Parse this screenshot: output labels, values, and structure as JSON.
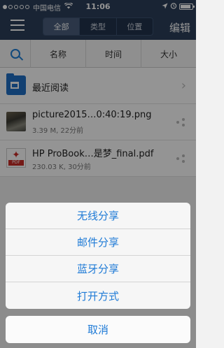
{
  "status_bar": {
    "carrier": "中国电信",
    "time": "11:06",
    "battery_level": 0.85
  },
  "nav": {
    "segments": [
      "全部",
      "类型",
      "位置"
    ],
    "edit_label": "编辑"
  },
  "sort": {
    "columns": [
      "名称",
      "时间",
      "大小"
    ]
  },
  "items": [
    {
      "icon": "folder-icon",
      "title": "最近阅读"
    },
    {
      "icon": "image-thumbnail",
      "title": "picture2015…0:40:19.png",
      "meta": "3.39 M, 22分前"
    },
    {
      "icon": "pdf-icon",
      "title": "HP ProBook…是梦_final.pdf",
      "meta": "230.03 K, 30分前"
    }
  ],
  "action_sheet": {
    "options": [
      "无线分享",
      "邮件分享",
      "蓝牙分享",
      "打开方式"
    ],
    "cancel": "取消"
  },
  "colors": {
    "nav_bg": "#2c3f5b",
    "accent": "#1e7ad6"
  }
}
